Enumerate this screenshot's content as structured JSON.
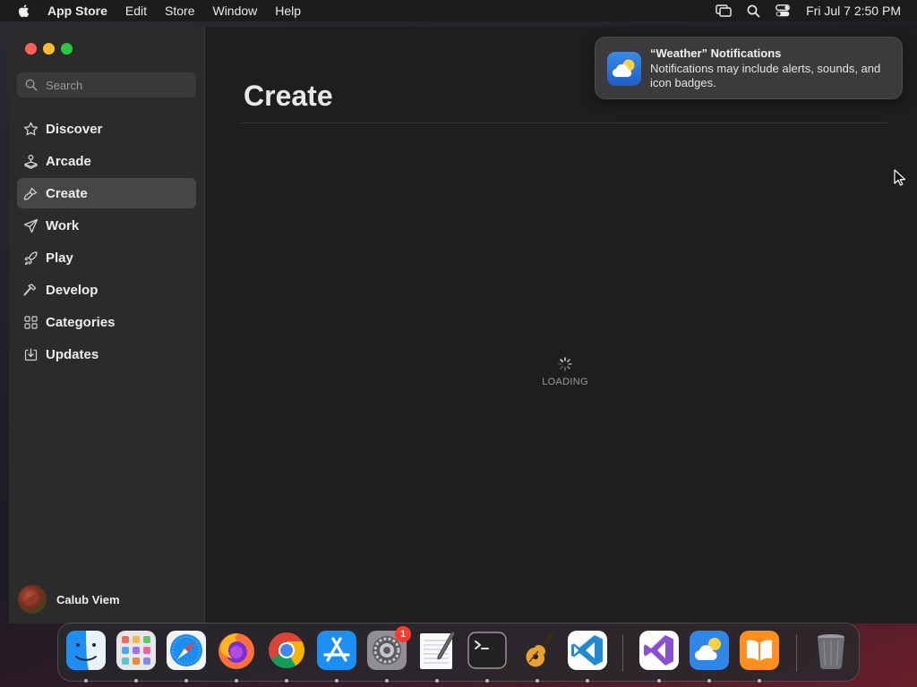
{
  "menubar": {
    "apple_icon": "apple-logo-icon",
    "app_name": "App Store",
    "menus": [
      "Edit",
      "Store",
      "Window",
      "Help"
    ],
    "status_icons": [
      "screen-mirroring-icon",
      "search-icon",
      "control-center-icon"
    ],
    "clock": "Fri Jul 7  2:50 PM"
  },
  "sidebar": {
    "search_placeholder": "Search",
    "items": [
      {
        "label": "Discover",
        "icon": "star-icon",
        "selected": false
      },
      {
        "label": "Arcade",
        "icon": "joystick-icon",
        "selected": false
      },
      {
        "label": "Create",
        "icon": "paintbrush-icon",
        "selected": true
      },
      {
        "label": "Work",
        "icon": "paper-plane-icon",
        "selected": false
      },
      {
        "label": "Play",
        "icon": "rocket-icon",
        "selected": false
      },
      {
        "label": "Develop",
        "icon": "hammer-icon",
        "selected": false
      },
      {
        "label": "Categories",
        "icon": "grid-icon",
        "selected": false
      },
      {
        "label": "Updates",
        "icon": "download-icon",
        "selected": false
      }
    ],
    "user_name": "Calub Viem"
  },
  "main": {
    "title": "Create",
    "loading_label": "LOADING"
  },
  "notification": {
    "title": "“Weather” Notifications",
    "body": "Notifications may include alerts, sounds, and icon badges.",
    "icon": "weather-icon"
  },
  "dock": {
    "items": [
      {
        "name": "finder",
        "running": true
      },
      {
        "name": "launchpad",
        "running": true
      },
      {
        "name": "safari",
        "running": true
      },
      {
        "name": "firefox",
        "running": true
      },
      {
        "name": "chrome",
        "running": true
      },
      {
        "name": "app-store",
        "running": true
      },
      {
        "name": "system-settings",
        "running": true,
        "badge": "1"
      },
      {
        "name": "textedit",
        "running": true
      },
      {
        "name": "terminal",
        "running": true
      },
      {
        "name": "garageband",
        "running": true
      },
      {
        "name": "vscode",
        "running": true
      },
      {
        "name": "visual-studio",
        "running": true
      },
      {
        "name": "weather",
        "running": true
      },
      {
        "name": "books",
        "running": true
      },
      {
        "name": "trash",
        "running": false
      }
    ]
  },
  "colors": {
    "close": "#ff5f57",
    "minimize": "#febc2e",
    "maximize": "#28c840",
    "badge": "#ff3b30",
    "sidebar_selected": "#464646"
  }
}
